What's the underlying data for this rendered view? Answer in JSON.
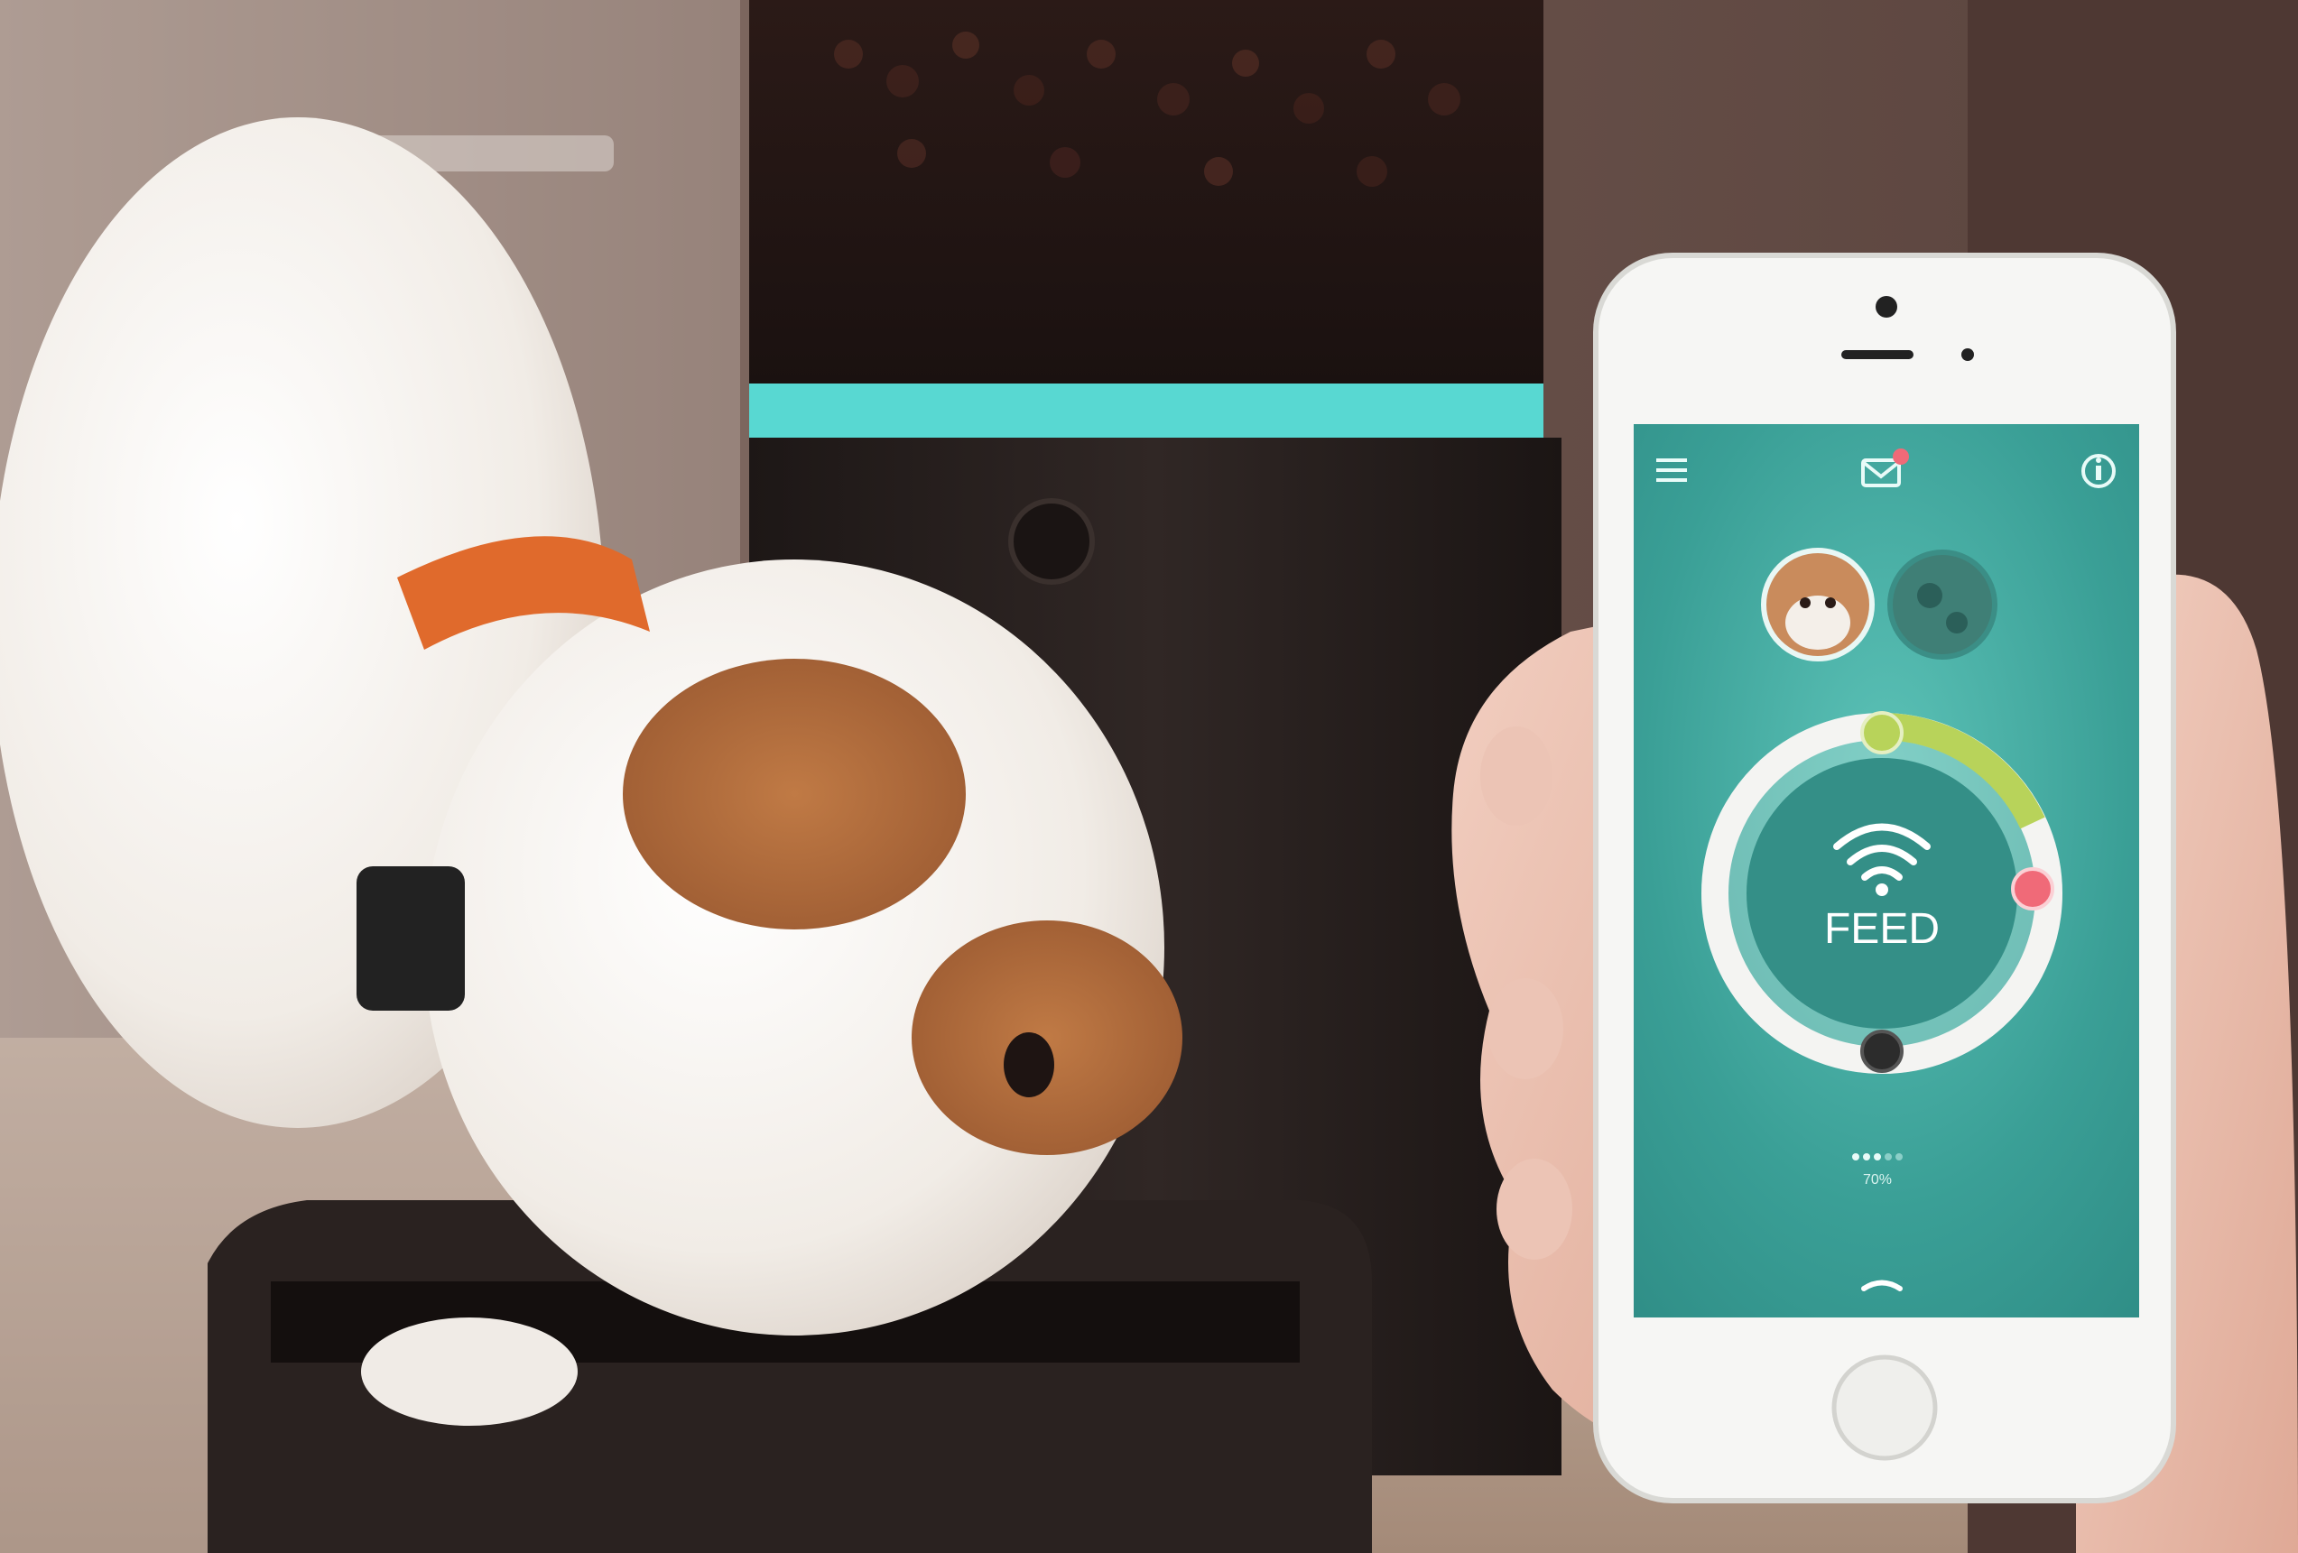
{
  "scene": {
    "description_colors": {
      "feeder_body": "#2a2220",
      "accent_teal": "#4fd6d0",
      "screen_teal": "#3aa89e",
      "ring_lime": "#b8d35a",
      "ring_pink": "#f06a78"
    }
  },
  "app": {
    "menu_icon": "hamburger-icon",
    "mail_icon": "envelope-icon",
    "info_icon": "info-icon",
    "wifi_icon": "wifi-icon",
    "feed_label": "FEED",
    "portion_value": "70%",
    "portion_fraction": 0.7,
    "handle_icon": "chevron-up-icon"
  }
}
